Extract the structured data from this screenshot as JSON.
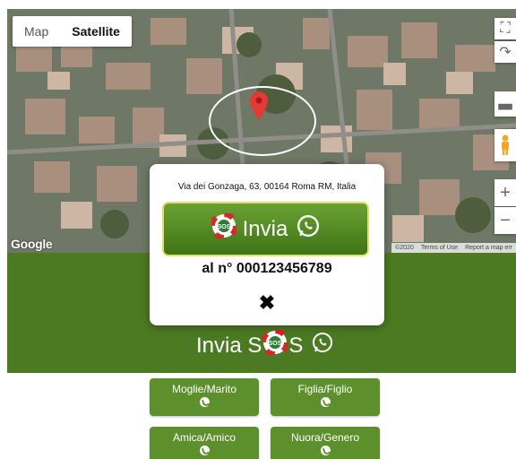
{
  "map": {
    "type_options": [
      {
        "label": "Map",
        "active": false
      },
      {
        "label": "Satellite",
        "active": true
      }
    ],
    "logo": "Google",
    "attribution": [
      "©2020",
      "Terms of Use",
      "Report a map err"
    ],
    "zoom_in": "+",
    "zoom_out": "−"
  },
  "modal": {
    "address": "Via dei Gonzaga, 63, 00164 Roma RM, Italia",
    "send_label": "Invia",
    "sos_badge": "SOS",
    "number": "al n° 000123456789",
    "close_symbol": "✖"
  },
  "panel": {
    "title_prefix": "Invia S",
    "title_badge": "SOS",
    "title_suffix": "S"
  },
  "relatives": [
    {
      "label": "Moglie/Marito"
    },
    {
      "label": "Figlia/Figlio"
    },
    {
      "label": "Amica/Amico"
    },
    {
      "label": "Nuora/Genero"
    }
  ],
  "colors": {
    "panel_green": "#4c7a22",
    "button_green": "#5d8f2c",
    "pin_red": "#e53935",
    "whatsapp_green": "#25d366"
  },
  "icons": {
    "pin": "map-pin-icon",
    "whatsapp": "whatsapp-icon",
    "sos": "sos-lifebuoy-icon",
    "phone": "phone-icon",
    "fullscreen": "fullscreen-icon",
    "rotate": "rotate-icon",
    "tilt": "tilt-icon",
    "pegman": "pegman-icon"
  }
}
